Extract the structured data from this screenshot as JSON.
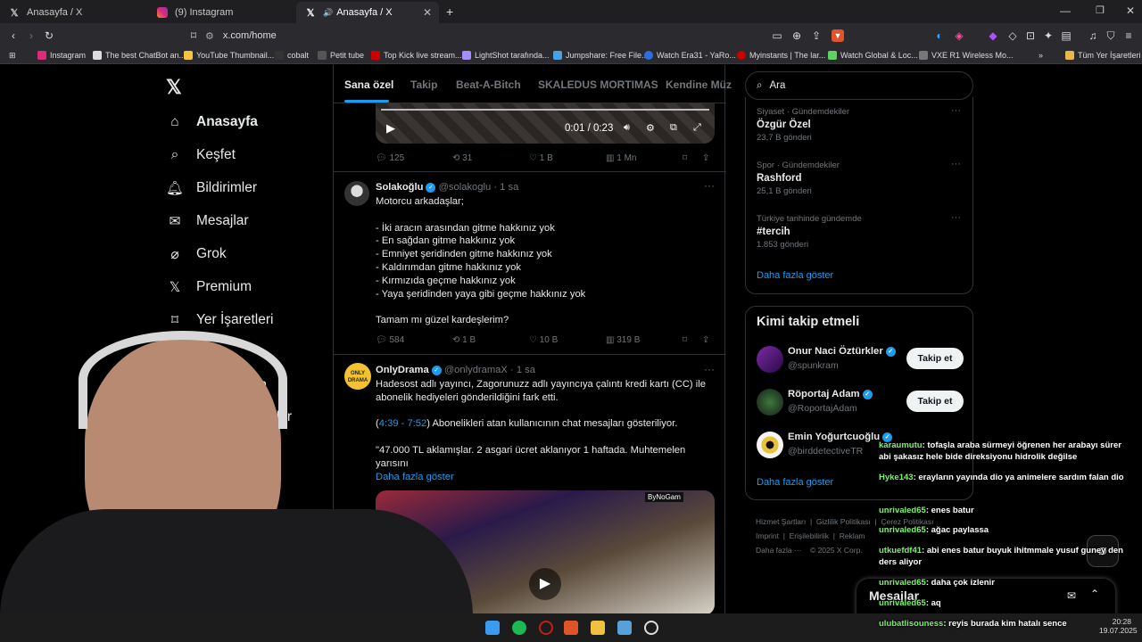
{
  "browser": {
    "tabs": [
      {
        "title": "Anasayfa / X",
        "icon": "x-logo-icon"
      },
      {
        "title": "(9) Instagram",
        "icon": "instagram-icon"
      },
      {
        "title": "Anasayfa / X",
        "icon": "x-logo-icon"
      }
    ],
    "url": "x.com/home",
    "bookmarks": [
      "Instagram",
      "The best ChatBot an...",
      "YouTube Thumbnail...",
      "cobalt",
      "Petit tube",
      "Top Kick live stream...",
      "LightShot tarafında...",
      "Jumpshare: Free File...",
      "Watch Era31 - YaRo...",
      "Myinstants | The lar...",
      "Watch Global & Loc...",
      "VXE R1 Wireless Mo..."
    ],
    "bookmarks_folder": "Tüm Yer İşaretleri"
  },
  "nav": {
    "items": [
      "Anasayfa",
      "Keşfet",
      "Bildirimler",
      "Mesajlar",
      "Grok",
      "Premium",
      "Yer İşaretleri"
    ],
    "partial_a": "rla",
    "partial_b": "luşlar"
  },
  "feed_tabs": [
    "Sana özel",
    "Takip",
    "Beat-A-Bitch",
    "SKALEDUS MORTIMAS",
    "Kendine Müz"
  ],
  "video1": {
    "time": "0:01 / 0:23"
  },
  "post0_actions": {
    "replies": "125",
    "reposts": "31",
    "likes": "1 B",
    "views": "1 Mn"
  },
  "post1": {
    "name": "Solakoğlu",
    "handle": "@solakoglu",
    "time": "· 1 sa",
    "lines": [
      "Motorcu arkadaşlar;",
      "",
      "- İki aracın arasından gitme hakkınız yok",
      "- En sağdan gitme hakkınız yok",
      "- Emniyet şeridinden gitme hakkınız yok",
      "- Kaldırımdan gitme hakkınız yok",
      "- Kırmızıda geçme hakkınız yok",
      "- Yaya şeridinden yaya gibi geçme hakkınız yok",
      "",
      "Tamam mı güzel kardeşlerim?"
    ],
    "replies": "584",
    "reposts": "1 B",
    "likes": "10 B",
    "views": "319 B"
  },
  "post2": {
    "name": "OnlyDrama",
    "handle": "@onlydramaX",
    "time": "· 1 sa",
    "line1": "Hadesost adlı yayıncı, Zagorunuzz adlı yayıncıya çalıntı kredi kartı (CC) ile",
    "line2": "abonelik hediyeleri gönderildiğini fark etti.",
    "ts_open": "(",
    "ts_link": "4:39 - 7:52",
    "ts_rest": ") Abonelikleri atan kullanıcının chat mesajları gösteriliyor.",
    "line4": "\"47.000 TL aklamışlar. 2 asgari ücret aklanıyor 1 haftada. Muhtemelen",
    "line5": "yarısını",
    "more": "Daha fazla göster",
    "watermark": "ByNoGam"
  },
  "search": {
    "placeholder": "Ara"
  },
  "trends": [
    {
      "category": "Siyaset · Gündemdekiler",
      "name": "Özgür Özel",
      "count": "23,7 B gönderi"
    },
    {
      "category": "Spor · Gündemdekiler",
      "name": "Rashford",
      "count": "25,1 B gönderi"
    },
    {
      "category": "Türkiye tarihinde gündemde",
      "name": "#tercih",
      "count": "1.853 gönderi"
    }
  ],
  "trends_more": "Daha fazla göster",
  "who_to_follow": {
    "title": "Kimi takip etmeli",
    "users": [
      {
        "name": "Onur Naci Öztürkler",
        "handle": "@spunkram"
      },
      {
        "name": "Röportaj Adam",
        "handle": "@RoportajAdam"
      },
      {
        "name": "Emin Yoğurtcuoğlu",
        "handle": "@birddetectiveTR"
      }
    ],
    "follow_label": "Takip et",
    "more": "Daha fazla göster"
  },
  "footer": {
    "links": [
      "Hizmet Şartları",
      "Gizlilik Politikası",
      "Çerez Politikası",
      "Imprint",
      "Erişilebilirlik",
      "Reklam",
      "Daha fazla ···",
      "© 2025 X Corp."
    ]
  },
  "messages_drawer": {
    "title": "Mesajlar"
  },
  "chat": [
    {
      "user": "karaumutu",
      "msg": "tofaşla araba sürmeyi öğrenen her arabayı sürer abi şakasız hele bide direksiyonu hidrolik değilse"
    },
    {
      "user": "Hyke143",
      "msg": "erayların yayında dio ya animelere sardım falan dio"
    },
    {
      "user": "unrivaled65",
      "msg": "enes batur"
    },
    {
      "user": "unrivaled65",
      "msg": "ağac paylassa"
    },
    {
      "user": "utkuefdf41",
      "msg": "abi enes batur buyuk ihitmmale yusuf guney den ders aliyor"
    },
    {
      "user": "unrivaled65",
      "msg": "daha çok izlenir"
    },
    {
      "user": "unrivaled65",
      "msg": "aq"
    },
    {
      "user": "ulubatlisouness",
      "msg": "reyis burada kim hatalı sence"
    }
  ],
  "taskbar": {
    "time": "20:28",
    "date": "19.07.2025"
  },
  "colors": {
    "accent": "#1d9bf0",
    "chat_user": "#7cf26c",
    "background": "#000000"
  }
}
